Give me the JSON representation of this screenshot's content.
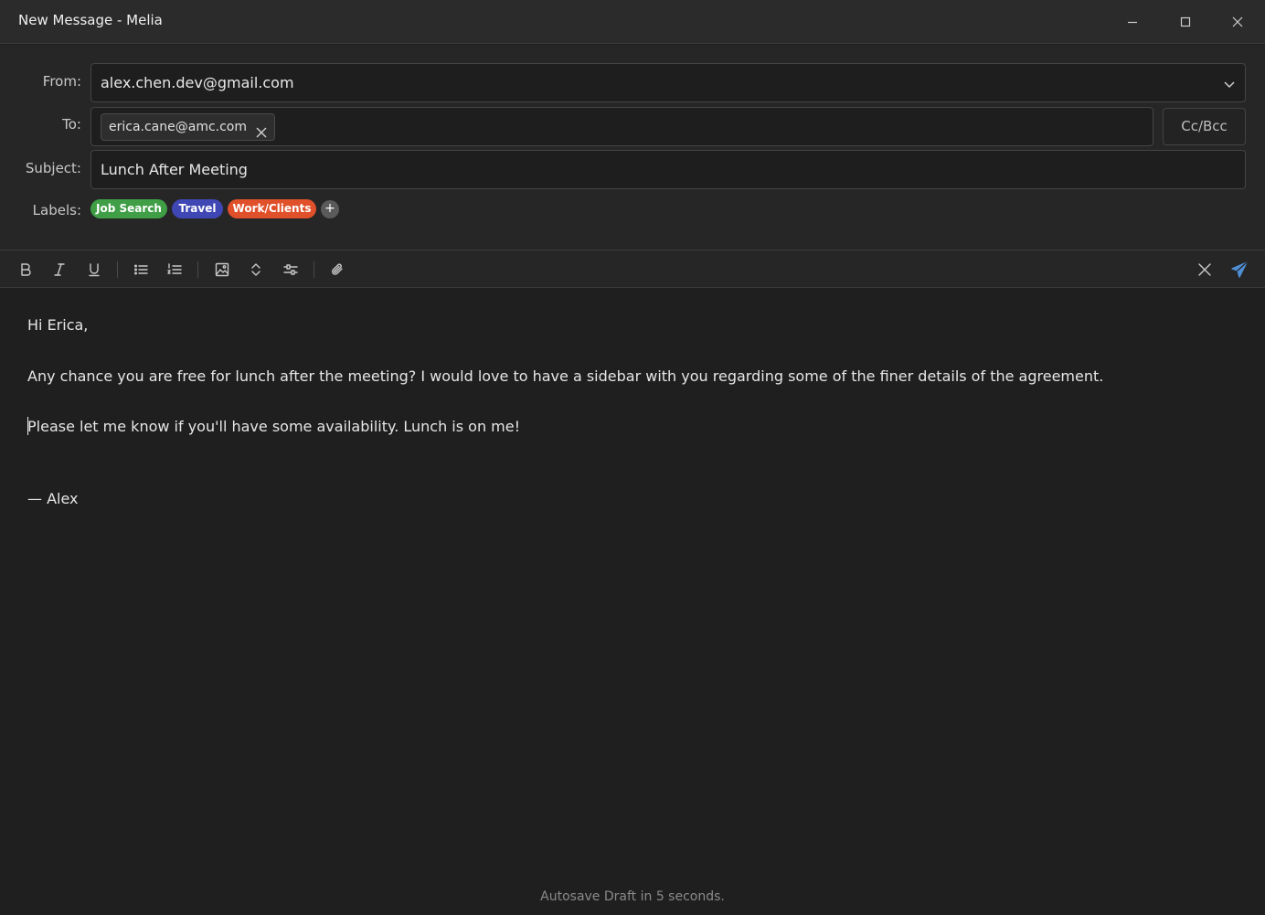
{
  "window": {
    "title": "New Message - Melia"
  },
  "compose": {
    "from_label": "From:",
    "from_value": "alex.chen.dev@gmail.com",
    "to_label": "To:",
    "to_recipients": [
      "erica.cane@amc.com"
    ],
    "cc_bcc_label": "Cc/Bcc",
    "subject_label": "Subject:",
    "subject_value": "Lunch After Meeting",
    "labels_label": "Labels:",
    "labels": [
      {
        "name": "Job Search",
        "color": "#3f9e46"
      },
      {
        "name": "Travel",
        "color": "#3f47b5"
      },
      {
        "name": "Work/Clients",
        "color": "#e0502a"
      }
    ],
    "add_label_symbol": "+"
  },
  "toolbar": {
    "icons": [
      "bold-icon",
      "italic-icon",
      "underline-icon",
      "bullet-list-icon",
      "numbered-list-icon",
      "image-icon",
      "expand-icon",
      "settings-sliders-icon",
      "paperclip-icon",
      "discard-icon",
      "send-icon"
    ],
    "send_color": "#4f8fd6"
  },
  "body": {
    "lines": [
      "Hi Erica,",
      "Any chance you are free for lunch after the meeting?  I would love to have a sidebar with you regarding some of the finer details of the agreement.",
      "Please let me know if you'll have some availability.  Lunch is on me!",
      "— Alex"
    ]
  },
  "status": {
    "autosave": "Autosave Draft in 5 seconds."
  }
}
